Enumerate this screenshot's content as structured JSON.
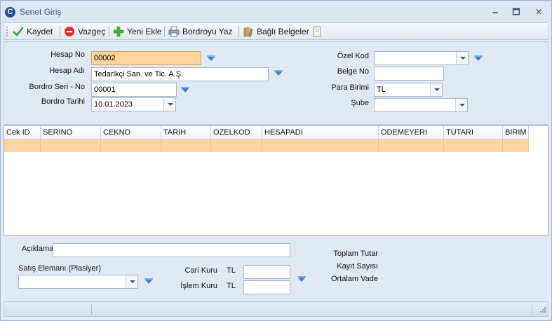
{
  "window": {
    "title": "Senet Giriş",
    "app_icon_letter": "C",
    "min": "🗕",
    "max": "🗖",
    "close": "✕"
  },
  "toolbar": {
    "save_label": "Kaydet",
    "cancel_label": "Vazgeç",
    "new_label": "Yeni Ekle",
    "print_label": "Bordroyu Yaz",
    "attachments_label": "Bağlı Belgeler"
  },
  "form": {
    "hesap_no": {
      "label": "Hesap No",
      "value": "00002"
    },
    "hesap_adi": {
      "label": "Hesap Adı",
      "value": "Tedarikçi San. ve Tic. A.Ş."
    },
    "bordro_seri_no": {
      "label": "Bordro Seri - No",
      "value": "00001"
    },
    "bordro_tarihi": {
      "label": "Bordro Tarihi",
      "value": "10.01.2023"
    },
    "ozel_kod": {
      "label": "Özel Kod",
      "value": ""
    },
    "belge_no": {
      "label": "Belge No",
      "value": ""
    },
    "para_birimi": {
      "label": "Para Birimi",
      "value": "TL"
    },
    "sube": {
      "label": "Şube",
      "value": ""
    }
  },
  "grid": {
    "columns": [
      "Cek ID",
      "SERINO",
      "CEKNO",
      "TARIH",
      "OZELKOD",
      "HESAPADI",
      "ODEMEYERI",
      "TUTARI",
      "BIRIM"
    ]
  },
  "footer": {
    "aciklama": {
      "label": "Açıklama",
      "value": ""
    },
    "plasiyer": {
      "label": "Satış Elemanı (Plasiyer)",
      "value": ""
    },
    "cari_kuru": {
      "label": "Cari Kuru",
      "currency": "TL",
      "value": ""
    },
    "islem_kuru": {
      "label": "İşlem Kuru",
      "currency": "TL",
      "value": ""
    },
    "toplam_tutar": "Toplam Tutar",
    "kayit_sayisi": "Kayıt Sayısı",
    "ortalam_vade": "Ortalam Vade"
  }
}
